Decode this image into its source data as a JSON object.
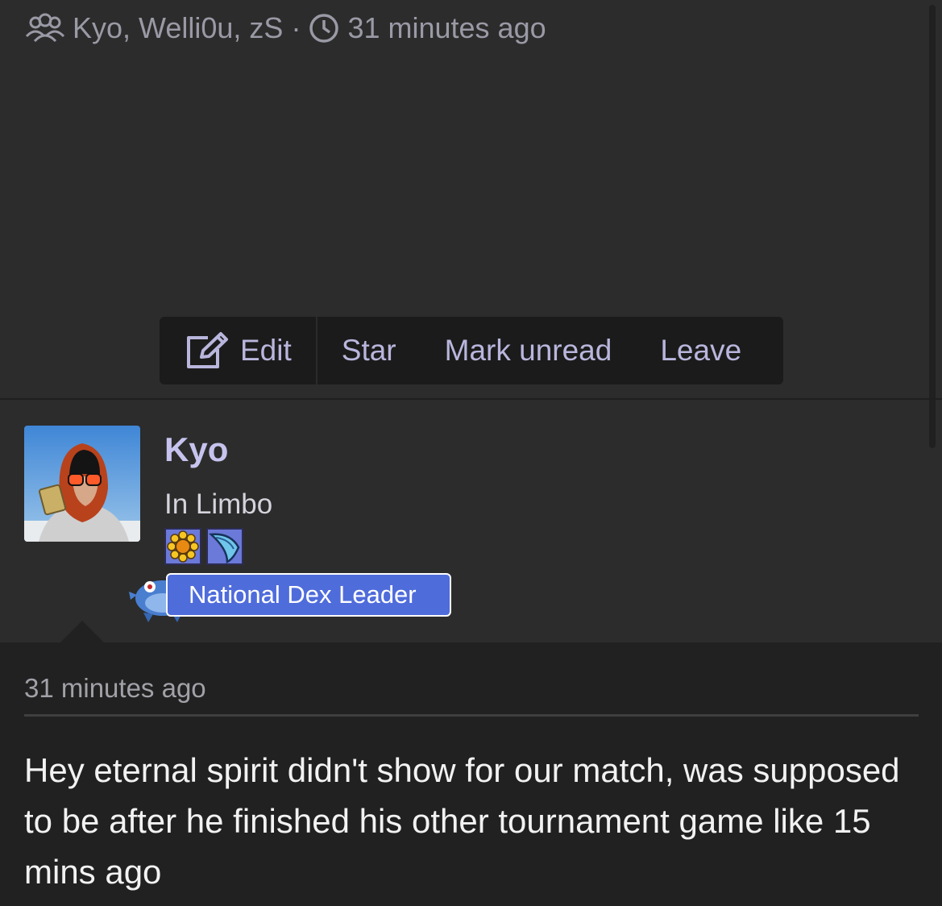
{
  "thread": {
    "participants": "Kyo, Welli0u, zS",
    "separator": "·",
    "time": "31 minutes ago"
  },
  "toolbar": {
    "edit_label": "Edit",
    "star_label": "Star",
    "mark_unread_label": "Mark unread",
    "leave_label": "Leave"
  },
  "author": {
    "name": "Kyo",
    "status": "In Limbo",
    "role": "National Dex Leader",
    "badges": [
      "sunflower-badge-icon",
      "blue-wing-badge-icon"
    ]
  },
  "message": {
    "time": "31 minutes ago",
    "body": "Hey eternal spirit didn't show for our match, was supposed to be after he finished his other tournament game like 15 mins ago"
  },
  "colors": {
    "background": "#2c2c2c",
    "toolbar": "#1b1b1b",
    "accent_text": "#b9b6dd",
    "role_badge": "#4f6cdb",
    "message_panel": "#212121"
  }
}
